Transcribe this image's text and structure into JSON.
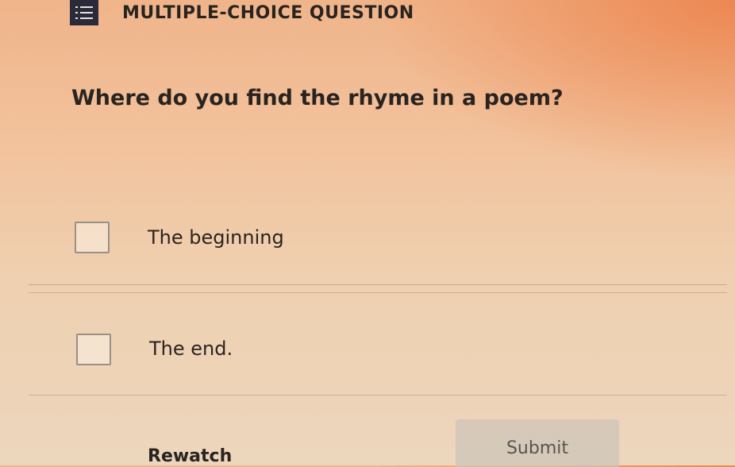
{
  "header": {
    "icon": "list-icon",
    "title": "MULTIPLE-CHOICE QUESTION"
  },
  "question": {
    "text": "Where do you find the rhyme in a poem?"
  },
  "choices": [
    {
      "label": "The beginning",
      "checked": false
    },
    {
      "label": "The end.",
      "checked": false
    }
  ],
  "actions": {
    "rewatch_label": "Rewatch",
    "submit_label": "Submit"
  },
  "colors": {
    "accent": "#ec8048",
    "header_icon_bg": "#2b2a3a",
    "text": "#2a2420"
  }
}
